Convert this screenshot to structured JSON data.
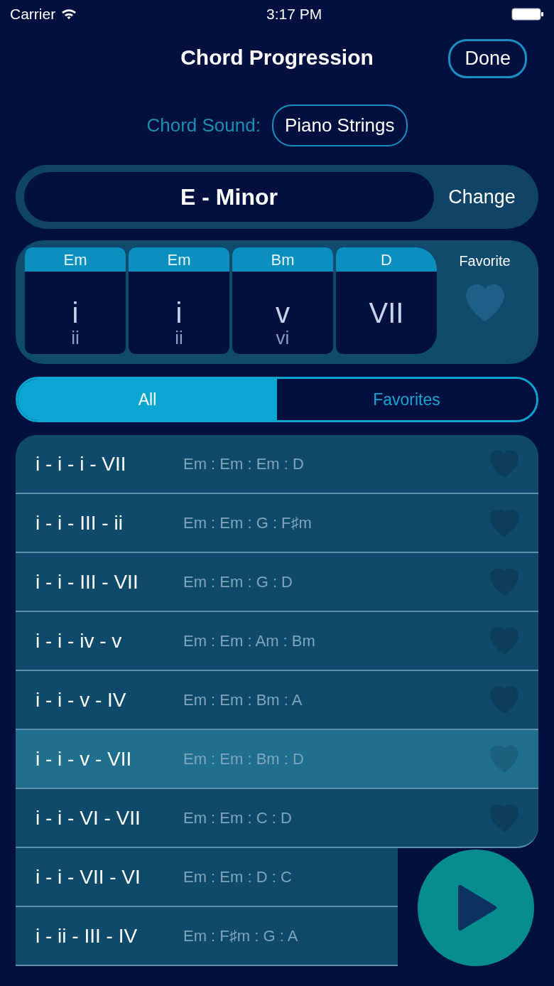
{
  "status_bar": {
    "carrier": "Carrier",
    "time": "3:17 PM"
  },
  "header": {
    "title": "Chord Progression",
    "done": "Done"
  },
  "sound": {
    "label": "Chord Sound:",
    "value": "Piano Strings"
  },
  "key": {
    "name": "E - Minor",
    "change": "Change"
  },
  "picker": {
    "columns": [
      {
        "chord": "Em",
        "current": "i",
        "below": "ii"
      },
      {
        "chord": "Em",
        "current": "i",
        "below": "ii"
      },
      {
        "chord": "Bm",
        "current": "v",
        "below": "vi"
      },
      {
        "chord": "D",
        "current": "VII"
      }
    ],
    "favorite_label": "Favorite",
    "favorite": false
  },
  "tabs": [
    {
      "label": "All",
      "selected": true
    },
    {
      "label": "Favorites",
      "selected": false
    }
  ],
  "progressions": [
    {
      "numerals": "i - i - i - VII",
      "chords": "Em : Em : Em : D",
      "favorite": false,
      "selected": false
    },
    {
      "numerals": "i - i - III - ii",
      "chords": "Em : Em : G : F♯m",
      "favorite": false,
      "selected": false
    },
    {
      "numerals": "i - i - III - VII",
      "chords": "Em : Em : G : D",
      "favorite": false,
      "selected": false
    },
    {
      "numerals": "i - i - iv - v",
      "chords": "Em : Em : Am : Bm",
      "favorite": false,
      "selected": false
    },
    {
      "numerals": "i - i - v - IV",
      "chords": "Em : Em : Bm : A",
      "favorite": false,
      "selected": false
    },
    {
      "numerals": "i - i - v - VII",
      "chords": "Em : Em : Bm : D",
      "favorite": false,
      "selected": true
    },
    {
      "numerals": "i - i - VI - VII",
      "chords": "Em : Em : C : D",
      "favorite": false,
      "selected": false
    },
    {
      "numerals": "i - i - VII - VI",
      "chords": "Em : Em : D : C",
      "selected": false
    },
    {
      "numerals": "i - ii - III - IV",
      "chords": "Em : F♯m : G : A",
      "selected": false
    }
  ]
}
